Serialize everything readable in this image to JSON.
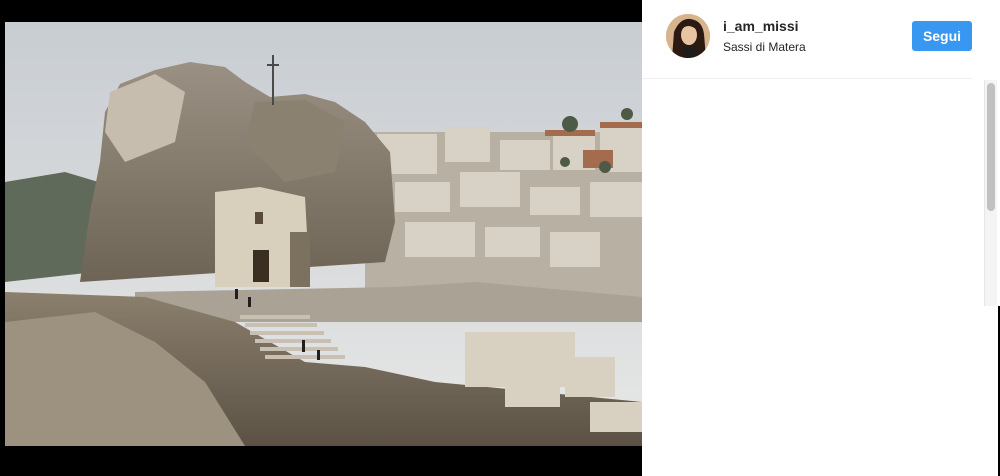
{
  "post": {
    "username": "i_am_missi",
    "location": "Sassi di Matera",
    "follow_label": "Segui"
  },
  "icons": {
    "avatar": "profile-photo"
  },
  "colors": {
    "follow_button": "#3897f0",
    "username": "#262626"
  }
}
